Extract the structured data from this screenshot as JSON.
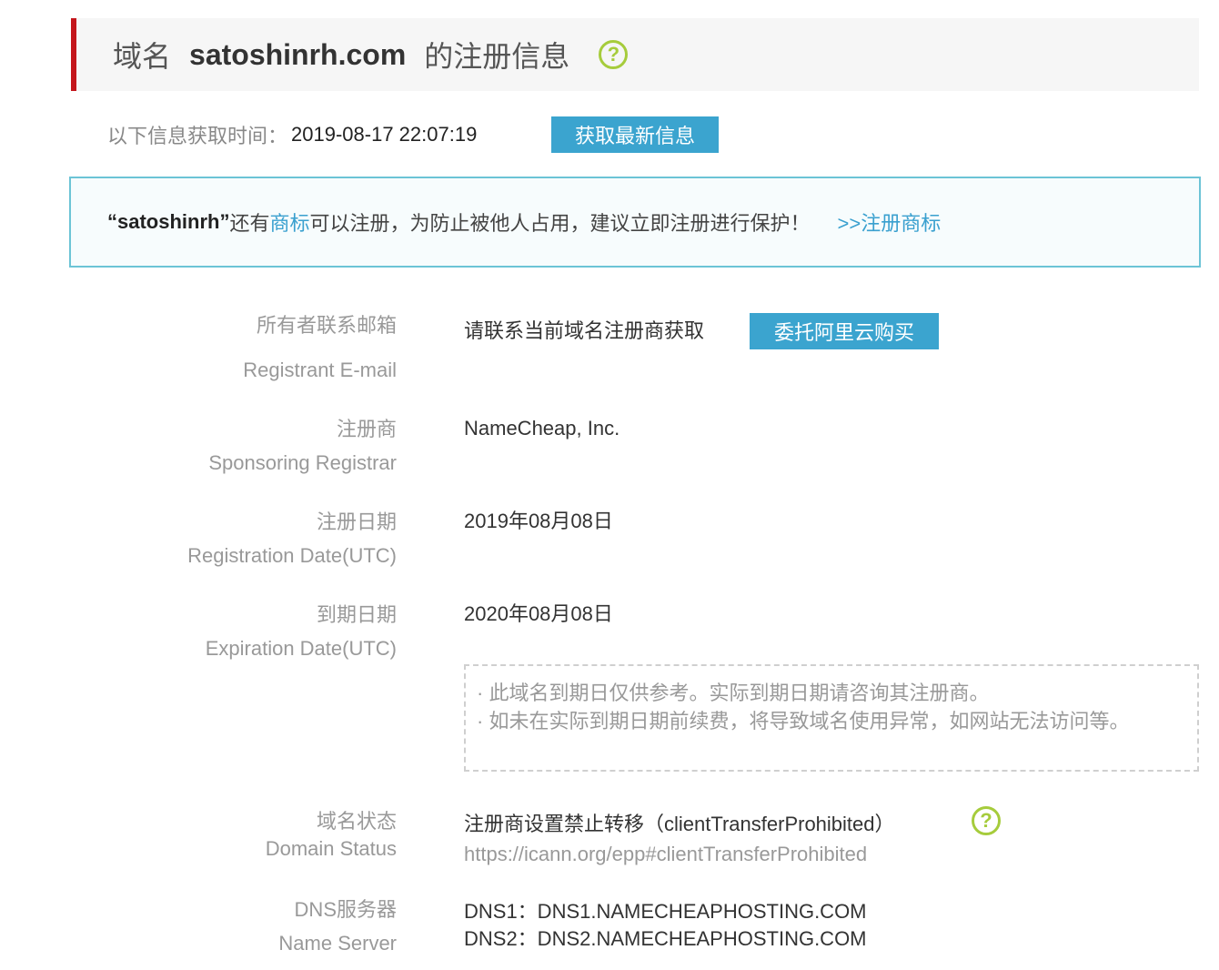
{
  "header": {
    "prefix": "域名",
    "domain": "satoshinrh.com",
    "suffix": "的注册信息",
    "help_icon": "question-circle-icon"
  },
  "fetch": {
    "label": "以下信息获取时间：",
    "time": "2019-08-17 22:07:19",
    "button": "获取最新信息"
  },
  "trademark_notice": {
    "name": "“satoshinrh”",
    "text_before_link": "还有",
    "link_word": "商标",
    "text_after_link": "可以注册，为防止被他人占用，建议立即注册进行保护！",
    "register_link": ">>注册商标"
  },
  "fields": {
    "email": {
      "label_cn": "所有者联系邮箱",
      "label_en": "Registrant E-mail",
      "value": "请联系当前域名注册商获取",
      "button": "委托阿里云购买"
    },
    "registrar": {
      "label_cn": "注册商",
      "label_en": "Sponsoring Registrar",
      "value": "NameCheap, Inc."
    },
    "registration_date": {
      "label_cn": "注册日期",
      "label_en": "Registration Date(UTC)",
      "value": "2019年08月08日"
    },
    "expiration_date": {
      "label_cn": "到期日期",
      "label_en": "Expiration Date(UTC)",
      "value": "2020年08月08日",
      "note_line1": "· 此域名到期日仅供参考。实际到期日期请咨询其注册商。",
      "note_line2": "· 如未在实际到期日期前续费，将导致域名使用异常，如网站无法访问等。"
    },
    "status": {
      "label_cn": "域名状态",
      "label_en": "Domain Status",
      "value": "注册商设置禁止转移（clientTransferProhibited）",
      "url": "https://icann.org/epp#clientTransferProhibited",
      "help_icon": "question-circle-icon"
    },
    "dns": {
      "label_cn": "DNS服务器",
      "label_en": "Name Server",
      "dns1": "DNS1：DNS1.NAMECHEAPHOSTING.COM",
      "dns2": "DNS2：DNS2.NAMECHEAPHOSTING.COM"
    }
  },
  "colors": {
    "accent_red": "#c4161c",
    "button_blue": "#3ba4cf",
    "link_blue": "#3aa0cf",
    "help_green": "#a6cc3c",
    "notice_border": "#6cc4d6"
  }
}
